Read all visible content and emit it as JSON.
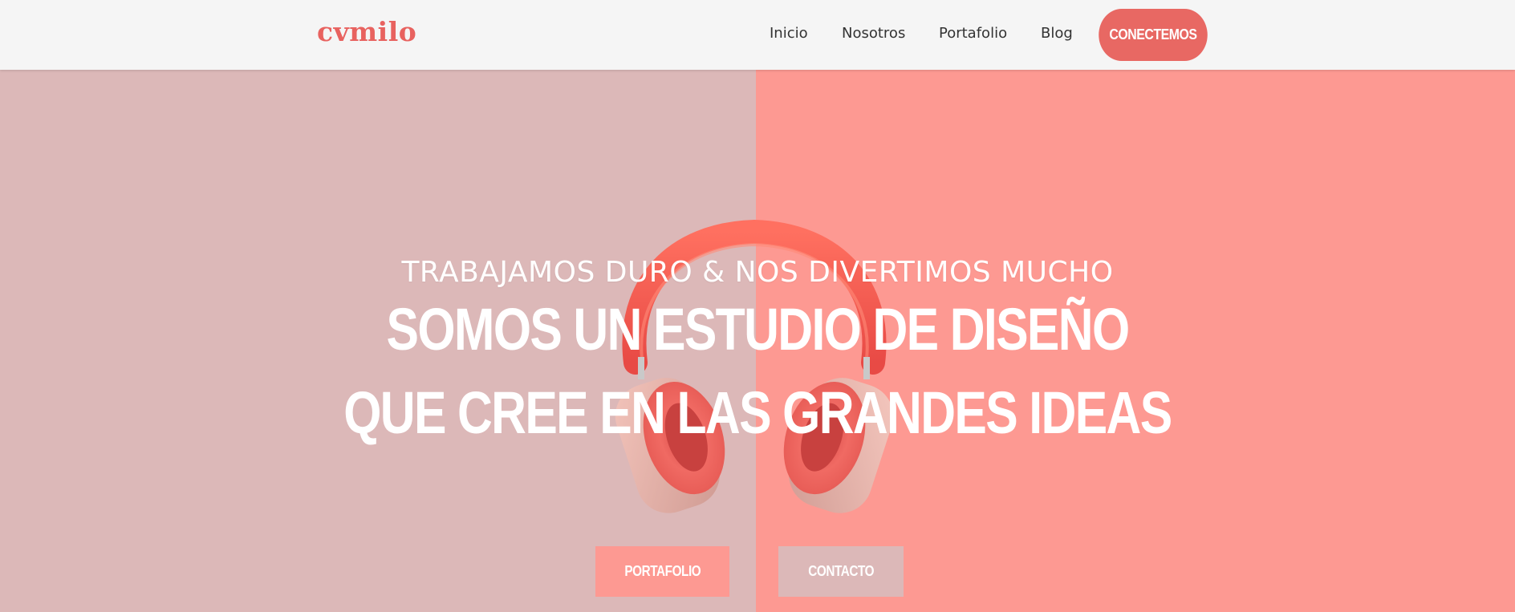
{
  "header": {
    "logo": "cvmilo",
    "nav": [
      {
        "label": "Inicio"
      },
      {
        "label": "Nosotros"
      },
      {
        "label": "Portafolio"
      },
      {
        "label": "Blog"
      }
    ],
    "cta_label": "CONECTEMOS"
  },
  "hero": {
    "tagline": "TRABAJAMOS DURO & NOS DIVERTIMOS MUCHO",
    "headline_line1": "SOMOS UN ESTUDIO DE DISEÑO",
    "headline_line2": "QUE CREE EN LAS GRANDES IDEAS",
    "buttons": {
      "portafolio": "PORTAFOLIO",
      "contacto": "CONTACTO"
    },
    "image": "headphones"
  },
  "colors": {
    "accent": "#e86863",
    "logo": "#e8625f",
    "hero_left": "#dcb8b8",
    "hero_right": "#fd9992",
    "header_bg": "#f5f5f5"
  }
}
